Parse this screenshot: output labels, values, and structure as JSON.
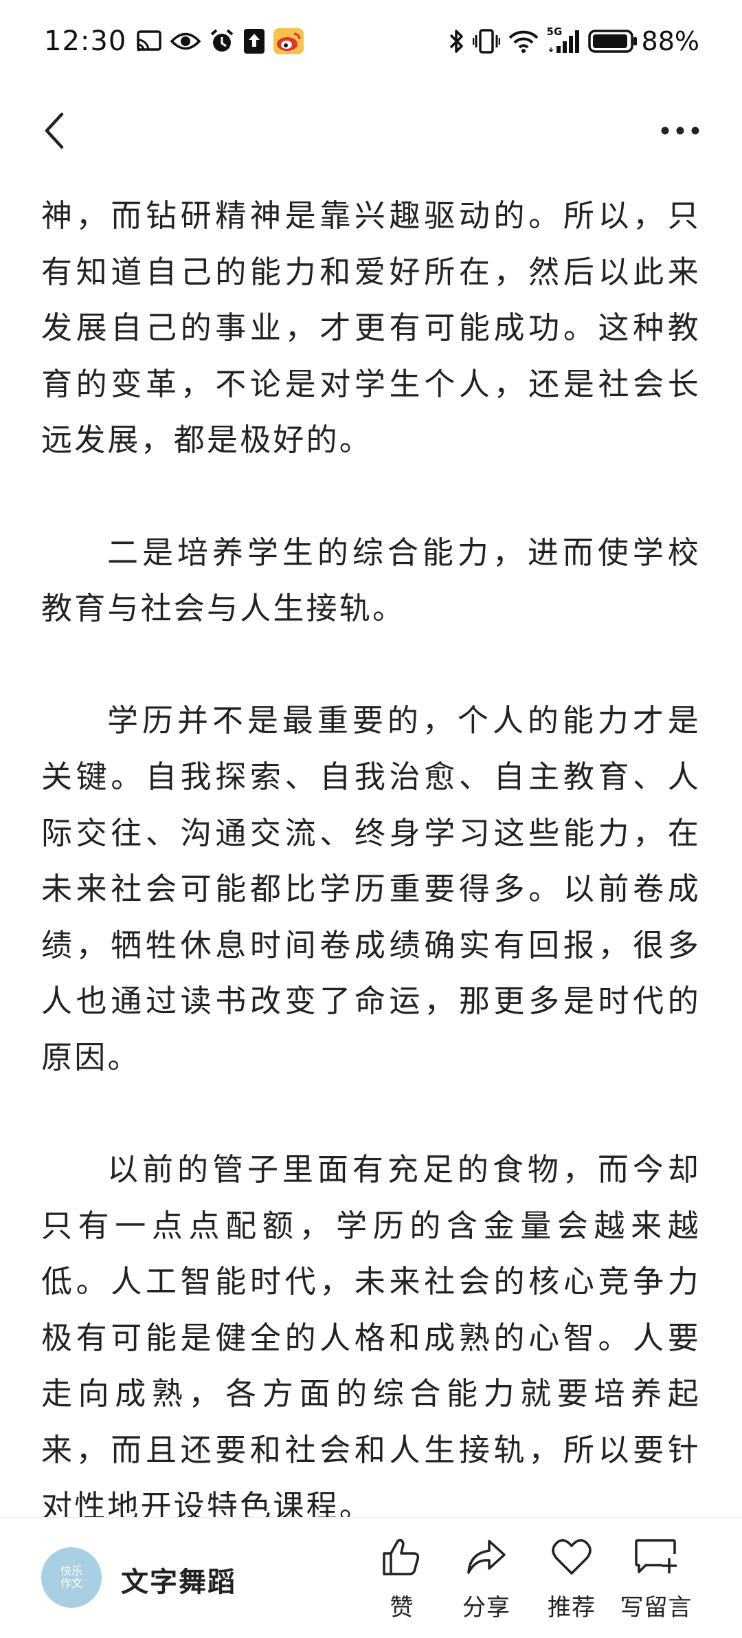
{
  "status_bar": {
    "time": "12:30",
    "battery": "88%",
    "network": "5G"
  },
  "icons": {
    "back": "chevron-left-icon",
    "more": "more-horizontal-icon",
    "like": "thumbs-up-icon",
    "share": "share-arrow-icon",
    "recommend": "heart-icon",
    "comment": "comment-add-icon"
  },
  "article": {
    "paragraphs": [
      "神，而钻研精神是靠兴趣驱动的。所以，只有知道自己的能力和爱好所在，然后以此来发展自己的事业，才更有可能成功。这种教育的变革，不论是对学生个人，还是社会长远发展，都是极好的。",
      "二是培养学生的综合能力，进而使学校教育与社会与人生接轨。",
      "学历并不是最重要的，个人的能力才是关键。自我探索、自我治愈、自主教育、人际交往、沟通交流、终身学习这些能力，在未来社会可能都比学历重要得多。以前卷成绩，牺牲休息时间卷成绩确实有回报，很多人也通过读书改变了命运，那更多是时代的原因。",
      "以前的管子里面有充足的食物，而今却只有一点点配额，学历的含金量会越来越低。人工智能时代，未来社会的核心竞争力极有可能是健全的人格和成熟的心智。人要走向成熟，各方面的综合能力就要培养起来，而且还要和社会和人生接轨，所以要针对性地开设特色课程。"
    ]
  },
  "bottom_bar": {
    "avatar_text": "快乐作文",
    "author_name": "文字舞蹈",
    "actions": {
      "like": "赞",
      "share": "分享",
      "recommend": "推荐",
      "comment": "写留言"
    }
  }
}
